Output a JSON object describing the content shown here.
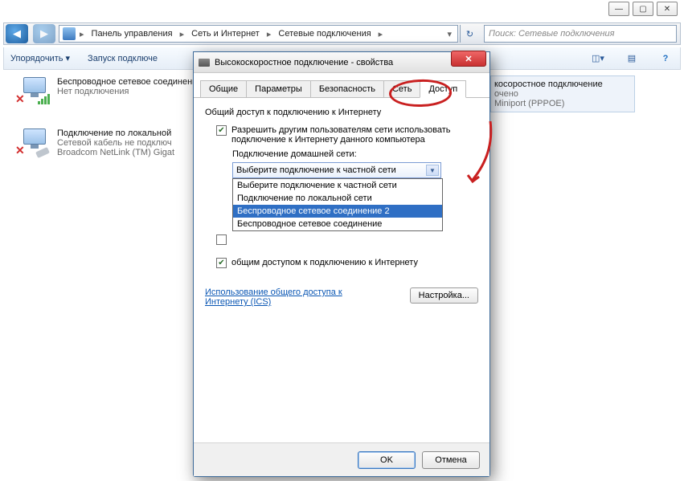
{
  "window_controls": {
    "min": "—",
    "max": "▢",
    "close": "✕"
  },
  "nav": {
    "back": "◀",
    "fwd": "▶"
  },
  "breadcrumb": {
    "items": [
      "Панель управления",
      "Сеть и Интернет",
      "Сетевые подключения"
    ]
  },
  "search": {
    "placeholder": "Поиск: Сетевые подключения"
  },
  "cmdbar": {
    "organize": "Упорядочить ▾",
    "launch": "Запуск подключе"
  },
  "connections": {
    "wifi": {
      "name": "Беспроводное сетевое соединение",
      "status": "Нет подключения"
    },
    "lan": {
      "name": "Подключение по локальной",
      "status": "Сетевой кабель не подключ",
      "adapter": "Broadcom NetLink (TM) Gigat"
    },
    "wan": {
      "name": "косоростное подключение",
      "status": "очено",
      "adapter": "Miniport (PPPOE)"
    }
  },
  "dialog": {
    "title": "Высокоскоростное подключение - свойства",
    "tabs": {
      "general": "Общие",
      "params": "Параметры",
      "security": "Безопасность",
      "net": "Сеть",
      "access": "Доступ"
    },
    "section": "Общий доступ к подключению к Интернету",
    "allow_checkbox": "Разрешить другим пользователям сети использовать подключение к Интернету данного компьютера",
    "home_label": "Подключение домашней сети:",
    "combo_value": "Выберите подключение к частной сети",
    "combo_options": [
      "Выберите подключение к частной сети",
      "Подключение по локальной сети",
      "Беспроводное сетевое соединение 2",
      "Беспроводное сетевое соединение"
    ],
    "manage_text": "общим доступом к подключению к Интернету",
    "link_text": "Использование общего доступа к Интернету (ICS)",
    "settings_btn": "Настройка...",
    "ok": "OK",
    "cancel": "Отмена",
    "close_x": "✕"
  }
}
